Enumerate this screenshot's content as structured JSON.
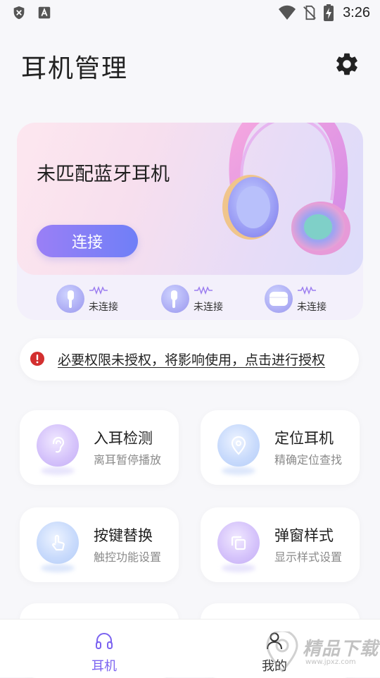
{
  "status_bar": {
    "time": "3:26",
    "icons": [
      "shield-x-icon",
      "a-box-icon",
      "wifi-icon",
      "no-sim-icon",
      "battery-charging-icon"
    ]
  },
  "header": {
    "title": "耳机管理",
    "settings_icon": "gear-icon"
  },
  "banner": {
    "title": "未匹配蓝牙耳机",
    "connect_label": "连接",
    "devices": [
      {
        "type": "left-earbud",
        "status": "未连接"
      },
      {
        "type": "right-earbud",
        "status": "未连接"
      },
      {
        "type": "charging-case",
        "status": "未连接"
      }
    ]
  },
  "permission_notice": {
    "text": "必要权限未授权，将影响使用，点击进行授权",
    "icon": "warning-icon",
    "color": "#d32f2f"
  },
  "features": [
    {
      "title": "入耳检测",
      "subtitle": "离耳暂停播放",
      "icon": "ear-icon"
    },
    {
      "title": "定位耳机",
      "subtitle": "精确定位查找",
      "icon": "location-pin-icon"
    },
    {
      "title": "按键替换",
      "subtitle": "触控功能设置",
      "icon": "touch-finger-icon"
    },
    {
      "title": "弹窗样式",
      "subtitle": "显示样式设置",
      "icon": "popup-window-icon"
    }
  ],
  "bottom_nav": {
    "items": [
      {
        "label": "耳机",
        "icon": "headphones-icon",
        "active": true
      },
      {
        "label": "我的",
        "icon": "person-icon",
        "active": false
      }
    ],
    "accent_color": "#7b63f0"
  },
  "watermark": {
    "text": "精品下载",
    "url": "www.jpxz.com"
  }
}
